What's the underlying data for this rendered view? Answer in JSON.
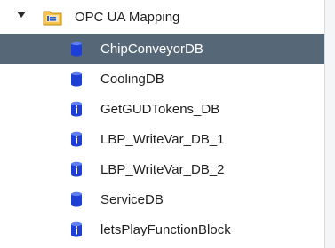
{
  "tree": {
    "root": {
      "label": "OPC UA Mapping",
      "icon": "folder-icon",
      "expanded": true
    },
    "items": [
      {
        "label": "ChipConveyorDB",
        "icon": "db-icon",
        "selected": true
      },
      {
        "label": "CoolingDB",
        "icon": "db-icon"
      },
      {
        "label": "GetGUDTokens_DB",
        "icon": "instance-db-icon"
      },
      {
        "label": "LBP_WriteVar_DB_1",
        "icon": "instance-db-icon"
      },
      {
        "label": "LBP_WriteVar_DB_2",
        "icon": "instance-db-icon"
      },
      {
        "label": "ServiceDB",
        "icon": "db-icon"
      },
      {
        "label": "letsPlayFunctionBlock",
        "icon": "instance-db-icon"
      }
    ]
  },
  "colors": {
    "selection": "#566878",
    "db_blue": "#1d3fd6",
    "instance_badge": "#ffffff"
  }
}
